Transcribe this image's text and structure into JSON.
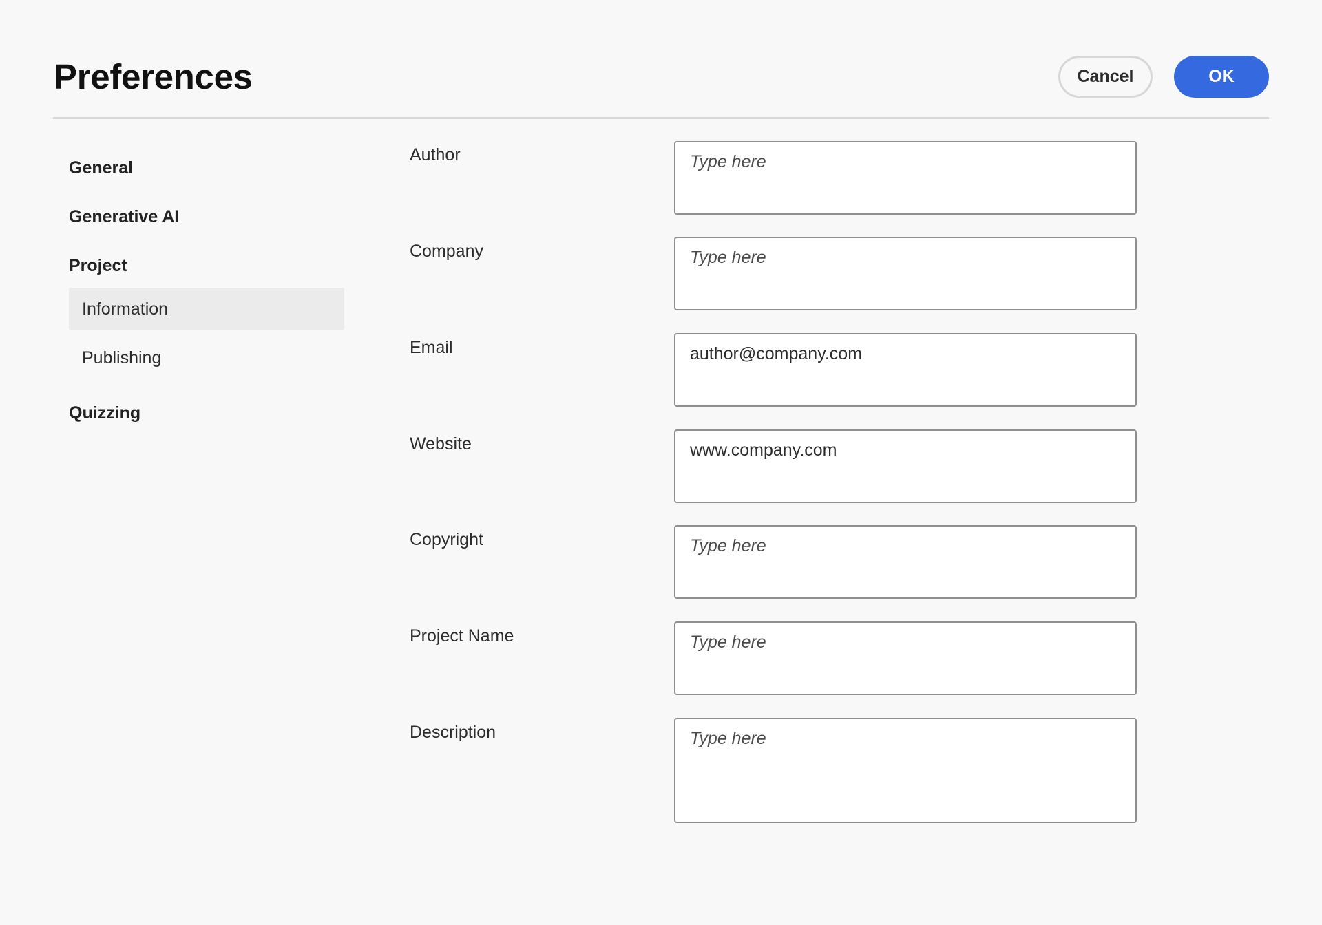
{
  "dialog": {
    "title": "Preferences",
    "cancel_label": "Cancel",
    "ok_label": "OK",
    "accent_color": "#3569e0"
  },
  "sidebar": {
    "sections": [
      {
        "label": "General"
      },
      {
        "label": "Generative AI"
      },
      {
        "label": "Project",
        "children": [
          {
            "label": "Information",
            "selected": true
          },
          {
            "label": "Publishing",
            "selected": false
          }
        ]
      },
      {
        "label": "Quizzing"
      }
    ]
  },
  "form": {
    "fields": [
      {
        "label": "Author",
        "value": "",
        "placeholder": "Type here"
      },
      {
        "label": "Company",
        "value": "",
        "placeholder": "Type here"
      },
      {
        "label": "Email",
        "value": "author@company.com",
        "placeholder": "Type here"
      },
      {
        "label": "Website",
        "value": "www.company.com",
        "placeholder": "Type here"
      },
      {
        "label": "Copyright",
        "value": "",
        "placeholder": "Type here"
      },
      {
        "label": "Project Name",
        "value": "",
        "placeholder": "Type here"
      },
      {
        "label": "Description",
        "value": "",
        "placeholder": "Type here"
      }
    ]
  }
}
